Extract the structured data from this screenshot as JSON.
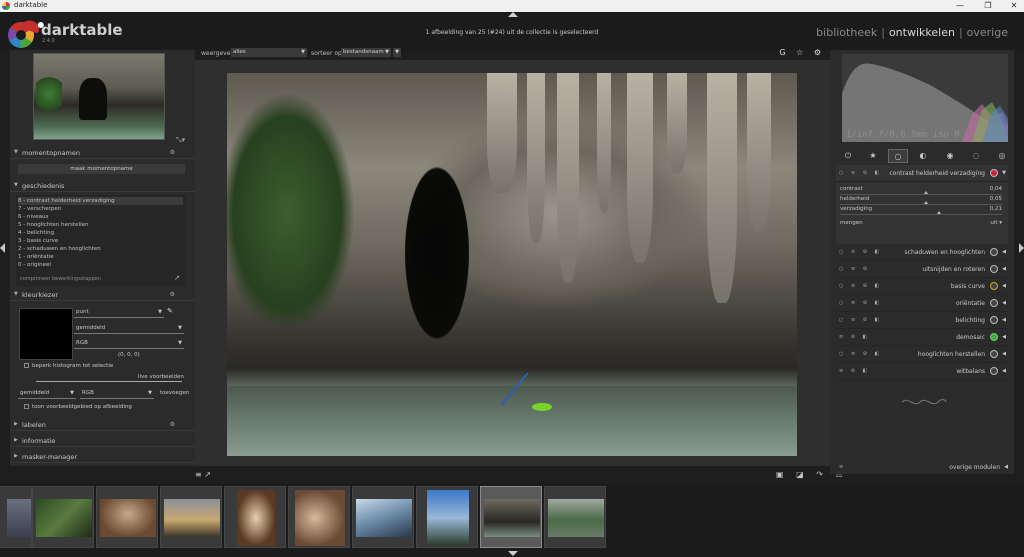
{
  "window": {
    "title": "darktable",
    "minimize": "—",
    "maximize": "❐",
    "close": "✕"
  },
  "header": {
    "app_name": "darktable",
    "version": "2.4.0",
    "collection_info": "1 afbeelding van 25 (#24) uit de collectie is geselecteerd",
    "views": {
      "library": "bibliotheek",
      "develop": "ontwikkelen",
      "other": "overige",
      "separator": "|"
    }
  },
  "left": {
    "snapshots": {
      "title": "momentopnamen",
      "button": "maak momentopname"
    },
    "history": {
      "title": "geschiedenis",
      "items": [
        "8 - contrast helderheid verzadiging",
        "7 - verscherpen",
        "6 - niveaus",
        "5 - hooglichten herstellen",
        "4 - belichting",
        "3 - basis curve",
        "2 - schaduwen en hooglichten",
        "1 - oriëntatie",
        "0 - origineel"
      ],
      "compress": "comprimeer bewerkingsstappen"
    },
    "colorpicker": {
      "title": "kleurkiezer",
      "mode": "punt",
      "stat": "gemiddeld",
      "model": "RGB",
      "value": "(0, 0, 0)",
      "restrict_histogram": "beperk histogram tot selectie",
      "live_samples": "live voorbeelden",
      "sample_stat": "gemiddeld",
      "sample_model": "RGB",
      "add": "toevoegen",
      "show_on_image": "toon voorbeeldgebied op afbeelding"
    },
    "collapsed": [
      "labelen",
      "informatie",
      "masker-manager"
    ]
  },
  "topbar": {
    "show_label": "weergeven",
    "show_value": "alles",
    "sort_label": "sorteer op",
    "sort_value": "bestandsnaam",
    "icons": "G ☆ ⚙"
  },
  "right": {
    "exif": "1/inf f/0,0 0mm iso 0",
    "module_groups": [
      "⏻",
      "★",
      "○",
      "◐",
      "◉",
      "◌",
      "◎"
    ],
    "expanded_module": {
      "name": "contrast helderheid verzadiging",
      "sliders": [
        {
          "label": "contrast",
          "value": "0,04",
          "pos": 0.52
        },
        {
          "label": "helderheid",
          "value": "0,05",
          "pos": 0.52
        },
        {
          "label": "verzadiging",
          "value": "0,21",
          "pos": 0.6
        }
      ],
      "blend_label": "mengen",
      "blend_value": "uit"
    },
    "modules": [
      "schaduwen en hooglichten",
      "uitsnijden en roteren",
      "basis curve",
      "oriëntatie",
      "belichting",
      "demosaic",
      "hooglichten herstellen",
      "witbalans"
    ],
    "other_modules": "overige modulen"
  },
  "bottom_icons_left": "≡ ↗",
  "bottom_icons_right": "▣ ◪ ↷ ⚠",
  "colors": {
    "accent_green": "#7cd02a",
    "panel": "#2b2b2b",
    "bg": "#1e1e1e"
  }
}
